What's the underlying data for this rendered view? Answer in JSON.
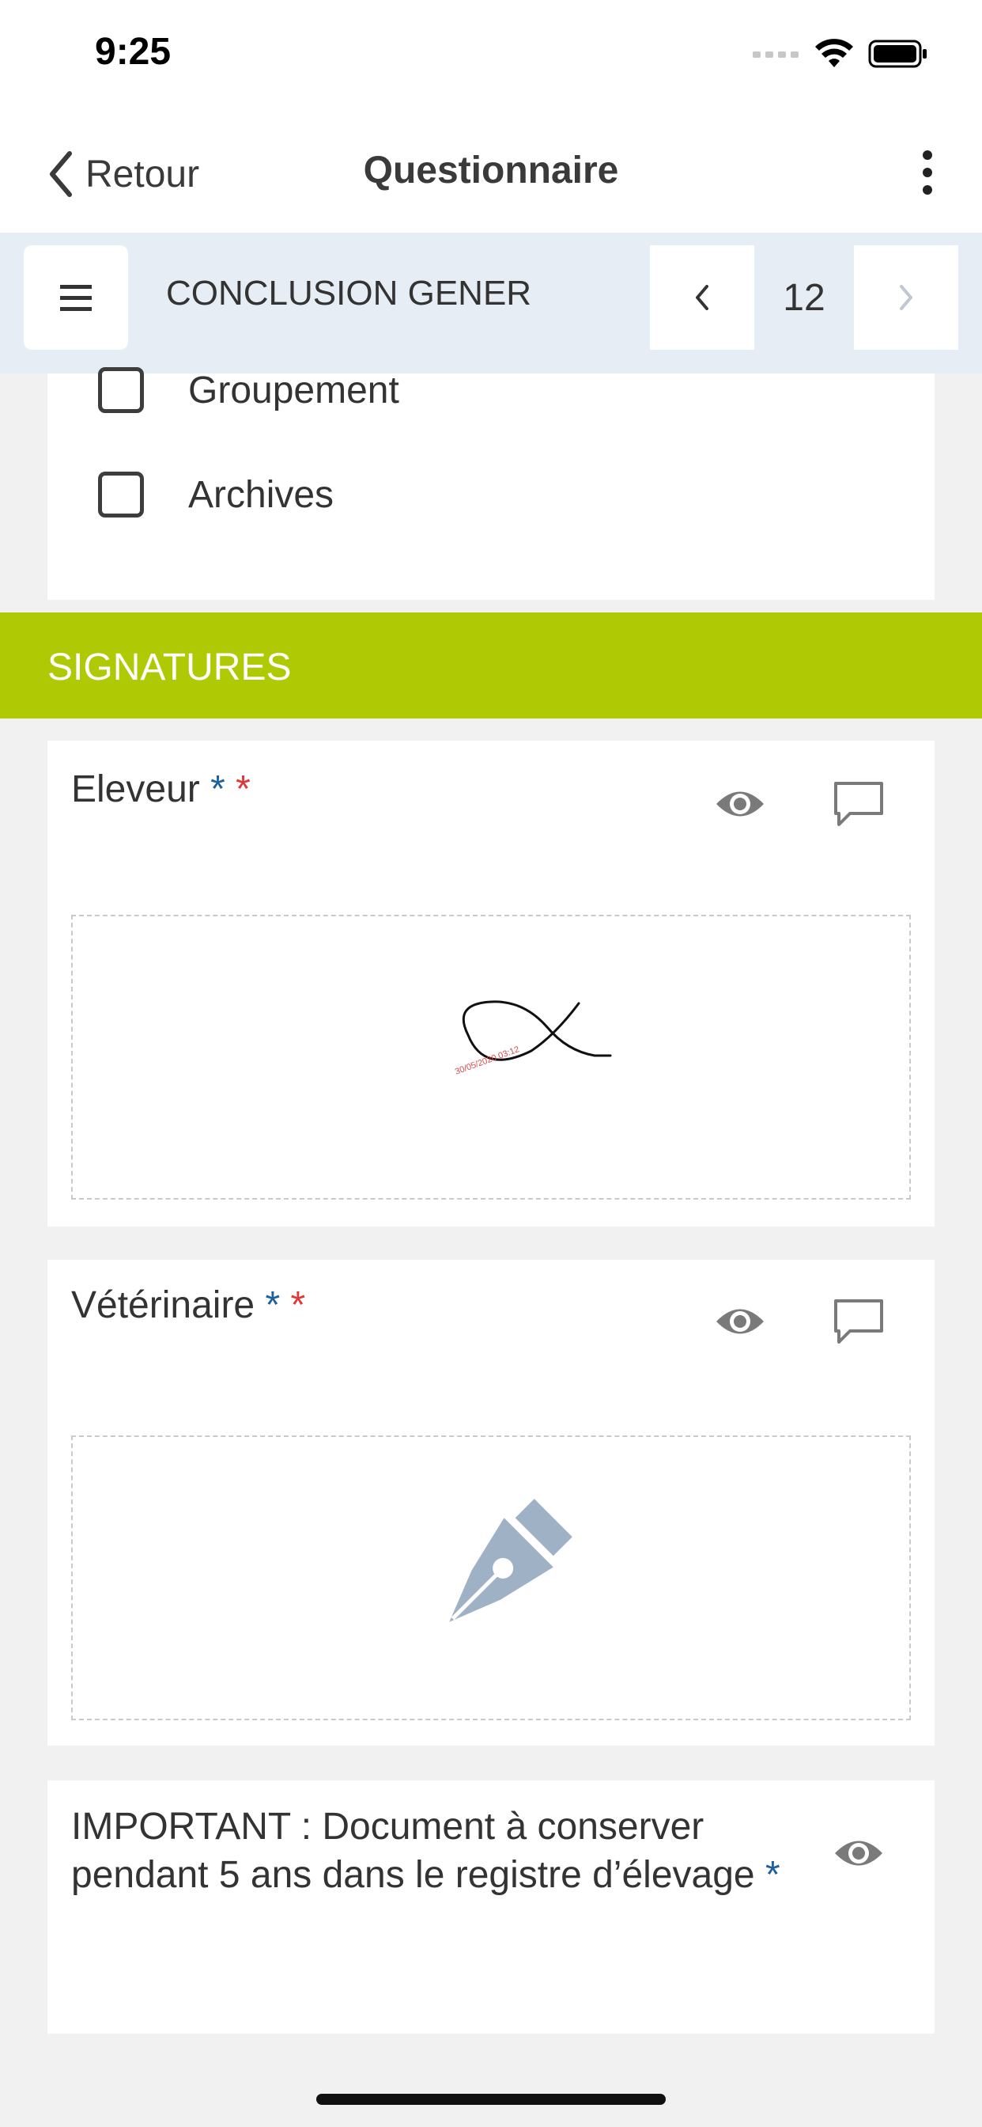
{
  "status_bar": {
    "time": "9:25"
  },
  "nav": {
    "back_label": "Retour",
    "title": "Questionnaire"
  },
  "section_nav": {
    "title": "CONCLUSION GENER",
    "page_number": "12"
  },
  "checkboxes": [
    {
      "label": "Groupement",
      "checked": false
    },
    {
      "label": "Archives",
      "checked": false
    }
  ],
  "banner": {
    "title": "SIGNATURES",
    "color": "#afc905"
  },
  "signatures": [
    {
      "label": "Eleveur",
      "required_star": "*",
      "mandatory_star": "*",
      "has_signature": true,
      "stamp_text": "30/05/2020 03:12"
    },
    {
      "label": "Vétérinaire",
      "required_star": "*",
      "mandatory_star": "*",
      "has_signature": false
    }
  ],
  "important": {
    "text": "IMPORTANT : Document à conserver pendant 5 ans dans le registre d’élevage",
    "required_star": "*"
  },
  "colors": {
    "accent_blue": "#1e5f9e",
    "required_red": "#e03838",
    "section_bg": "#e7edf4"
  }
}
